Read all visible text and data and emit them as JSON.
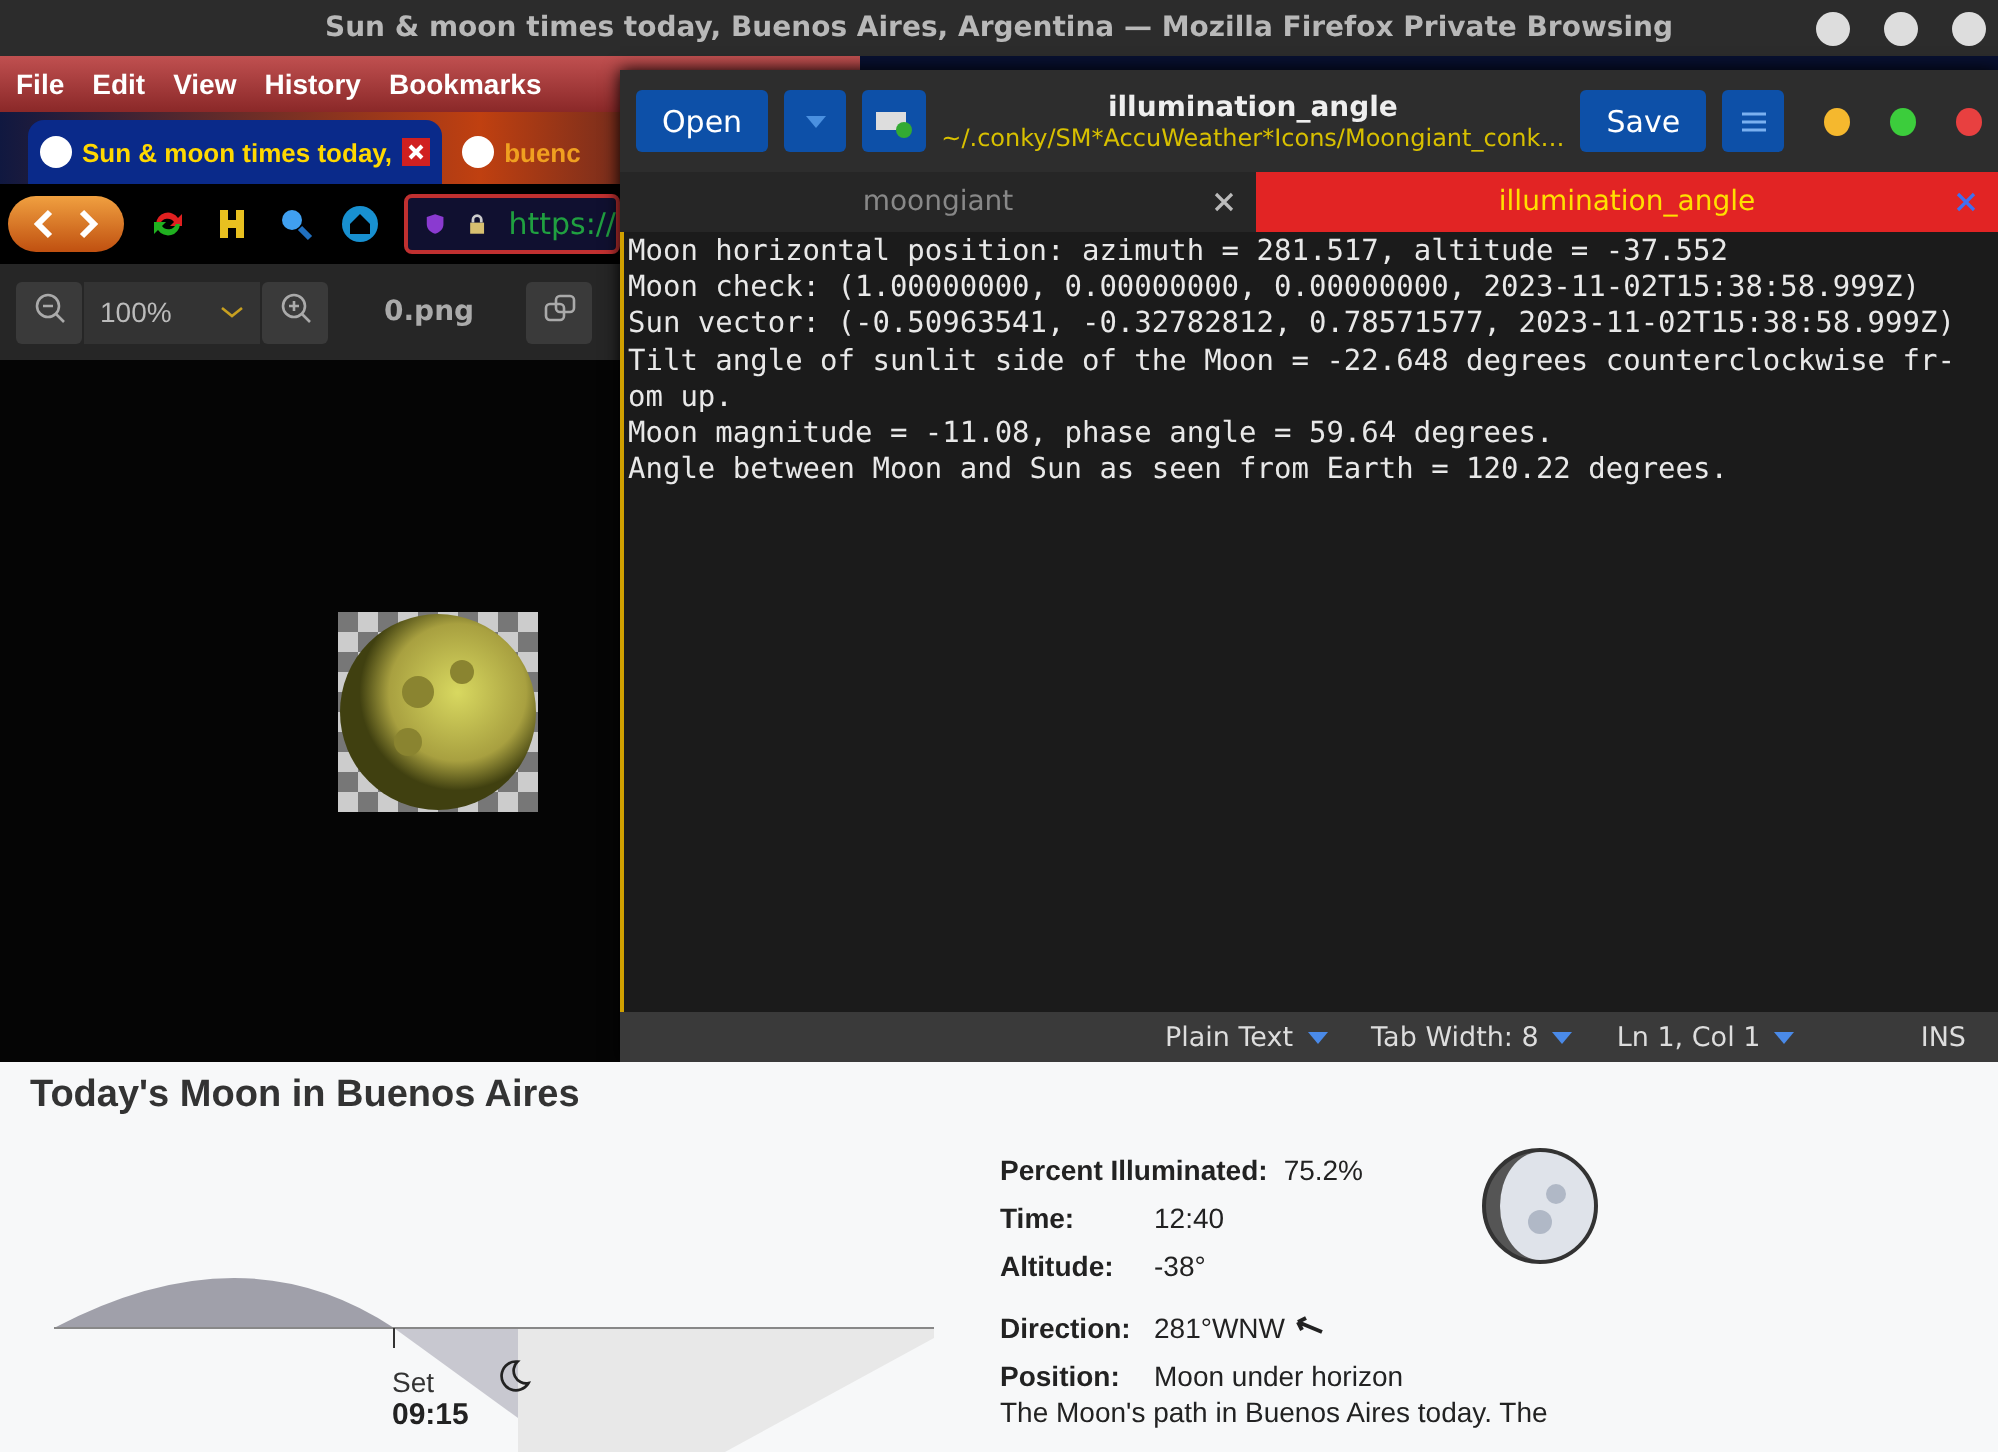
{
  "screen_title": "Sun & moon times today, Buenos Aires, Argentina — Mozilla Firefox Private Browsing",
  "firefox": {
    "menu": [
      "File",
      "Edit",
      "View",
      "History",
      "Bookmarks"
    ],
    "tabs": [
      {
        "title": "Sun & moon times today,",
        "selected": true
      },
      {
        "title": "buenc",
        "selected": false
      }
    ],
    "url": "https://"
  },
  "image_viewer": {
    "zoom": "100%",
    "file": "0.png"
  },
  "editor": {
    "open_label": "Open",
    "title": "illumination_angle",
    "path": "~/.conky/SM*AccuWeather*Icons/Moongiant_conk…",
    "save_label": "Save",
    "tabs": [
      {
        "label": "moongiant",
        "selected": false
      },
      {
        "label": "illumination_angle",
        "selected": true
      }
    ],
    "lines": [
      "Moon horizontal position: azimuth = 281.517, altitude = -37.552",
      "Moon check: (1.00000000, 0.00000000, 0.00000000, 2023-11-02T15:38:58.999Z)",
      "Sun vector: (-0.50963541, -0.32782812, 0.78571577, 2023-11-02T15:38:58.999Z)",
      "Tilt angle of sunlit side of the Moon = -22.648 degrees counterclockwise fr-",
      "om up.",
      "Moon magnitude = -11.08, phase angle = 59.64 degrees.",
      "Angle between Moon and Sun as seen from Earth = 120.22 degrees."
    ],
    "status": {
      "language": "Plain Text",
      "tab_width": "Tab Width: 8",
      "position": "Ln 1, Col 1",
      "mode": "INS"
    }
  },
  "moon_page": {
    "title": "Today's Moon in Buenos Aires",
    "set_label": "Set",
    "set_time": "09:15",
    "facts": [
      {
        "label": "Percent Illuminated:",
        "value": "75.2%"
      },
      {
        "label": "Time:",
        "value": "12:40"
      },
      {
        "label": "Altitude:",
        "value": "-38°"
      },
      {
        "label": "Direction:",
        "value": "281°WNW"
      },
      {
        "label": "Position:",
        "value": "Moon under horizon"
      }
    ],
    "caption": "The Moon's path in Buenos Aires today. The"
  }
}
